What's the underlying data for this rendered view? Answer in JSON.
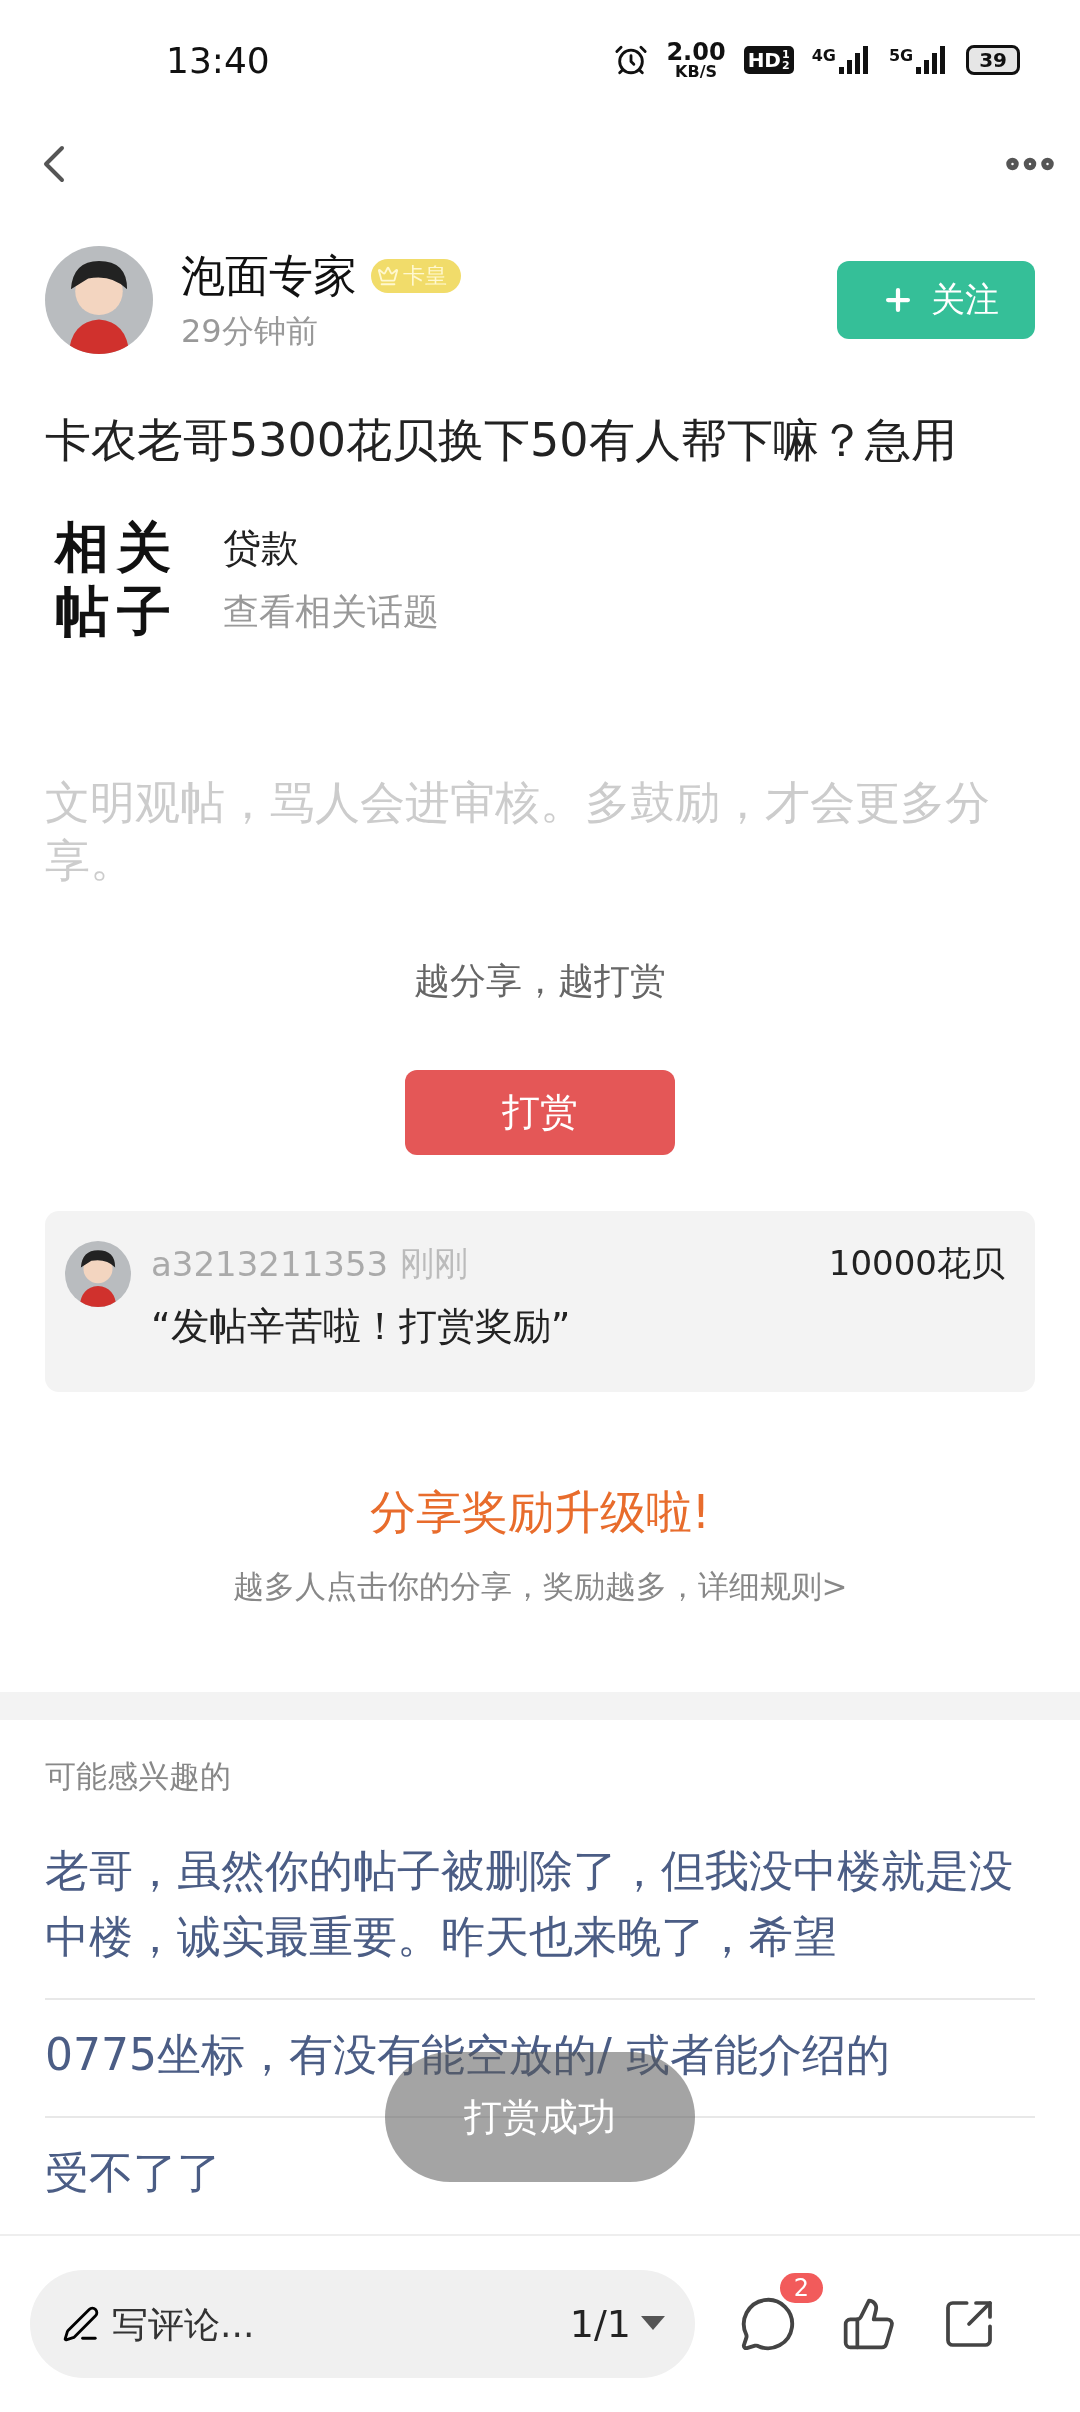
{
  "status_bar": {
    "time": "13:40",
    "speed": "2.00",
    "speed_unit": "KB/S",
    "hd": "HD",
    "hd_sims": [
      "1",
      "2"
    ],
    "networks": [
      "4G",
      "5G"
    ],
    "battery": "39"
  },
  "post": {
    "author": "泡面专家",
    "badge": "卡皇",
    "time": "29分钟前",
    "follow_label": "关注",
    "title": "卡农老哥5300花贝换下50有人帮下嘛？急用",
    "related": {
      "heading": "相关帖子",
      "topic": "贷款",
      "link": "查看相关话题"
    },
    "notice": "文明观帖，骂人会进审核。多鼓励，才会更多分享。",
    "reward_prompt": "越分享，越打赏",
    "reward_button": "打赏"
  },
  "reward_record": {
    "user": "a3213211353",
    "time": "刚刚",
    "amount": "10000花贝",
    "message": "“发帖辛苦啦！打赏奖励”"
  },
  "share_promo": {
    "title": "分享奖励升级啦!",
    "subtitle": "越多人点击你的分享，奖励越多，详细规则>"
  },
  "recommendations": {
    "heading": "可能感兴趣的",
    "items": [
      "老哥，虽然你的帖子被删除了，但我没中楼就是没中楼，诚实最重要。昨天也来晚了，希望",
      "0775坐标，有没有能空放的/ 或者能介绍的",
      "受不了了"
    ]
  },
  "toast": "打赏成功",
  "bottom_bar": {
    "placeholder": "写评论...",
    "page": "1/1",
    "comment_count": "2"
  }
}
